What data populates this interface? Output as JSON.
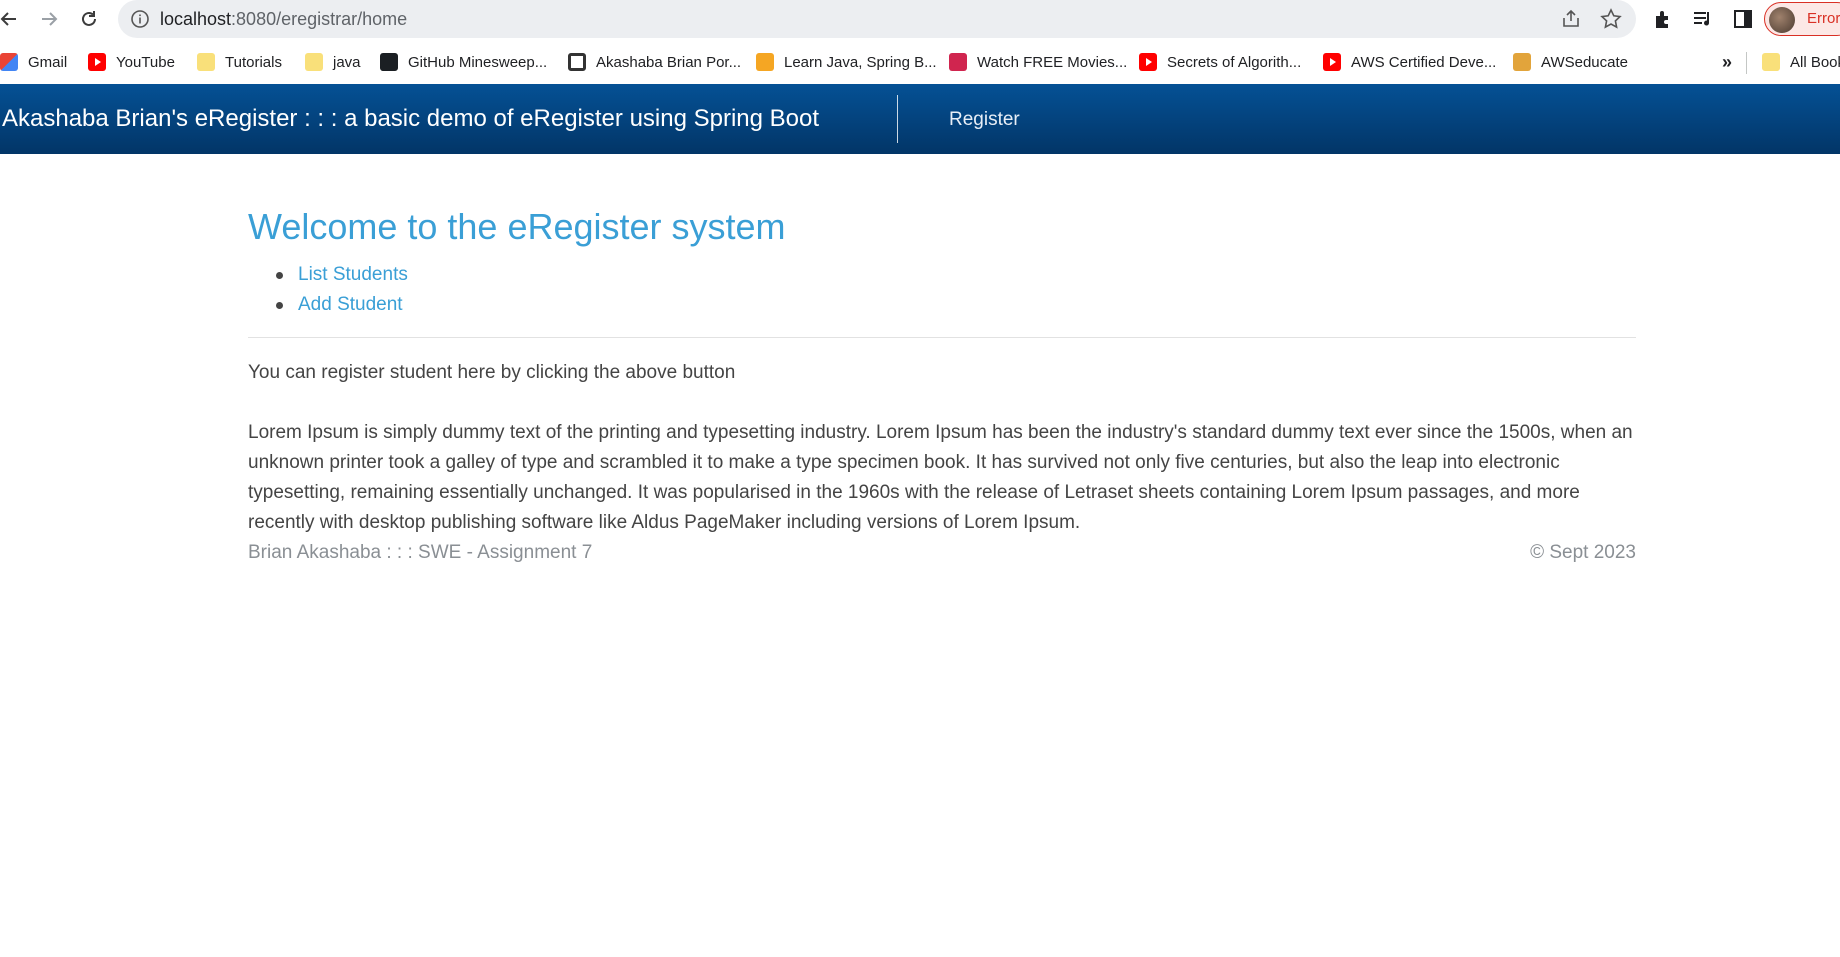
{
  "browser": {
    "url_host": "localhost",
    "url_rest": ":8080/eregistrar/home",
    "profile_label": "Error"
  },
  "bookmarks": [
    {
      "label": "Gmail",
      "icon": "gmail-icon"
    },
    {
      "label": "YouTube",
      "icon": "youtube-icon"
    },
    {
      "label": "Tutorials",
      "icon": "folder-icon"
    },
    {
      "label": "java",
      "icon": "folder-icon"
    },
    {
      "label": "GitHub Minesweep...",
      "icon": "github-icon"
    },
    {
      "label": "Akashaba Brian Por...",
      "icon": "globe-icon"
    },
    {
      "label": "Learn Java, Spring B...",
      "icon": "code-icon"
    },
    {
      "label": "Watch FREE Movies...",
      "icon": "movie-icon"
    },
    {
      "label": "Secrets of Algorith...",
      "icon": "youtube-icon"
    },
    {
      "label": "AWS Certified Deve...",
      "icon": "youtube-icon"
    },
    {
      "label": "AWSeducate",
      "icon": "aws-icon"
    }
  ],
  "bookmarks_more": "»",
  "bookmarks_all": "All Bookmarks",
  "header": {
    "brand": "Akashaba Brian's eRegister : : : a basic demo of eRegister using Spring Boot",
    "nav_register": "Register",
    "colors": {
      "top": "#055195",
      "bottom": "#023567"
    }
  },
  "main": {
    "title": "Welcome to the eRegister system",
    "links": [
      "List Students",
      "Add Student"
    ],
    "lead": "You can register student here by clicking the above button",
    "body": "Lorem Ipsum is simply dummy text of the printing and typesetting industry. Lorem Ipsum has been the industry's standard dummy text ever since the 1500s, when an unknown printer took a galley of type and scrambled it to make a type specimen book. It has survived not only five centuries, but also the leap into electronic typesetting, remaining essentially unchanged. It was popularised in the 1960s with the release of Letraset sheets containing Lorem Ipsum passages, and more recently with desktop publishing software like Aldus PageMaker including versions of Lorem Ipsum.",
    "accent_color": "#3a9fd6"
  },
  "footer": {
    "left": "Brian Akashaba : : : SWE - Assignment 7",
    "right": "© Sept 2023"
  }
}
